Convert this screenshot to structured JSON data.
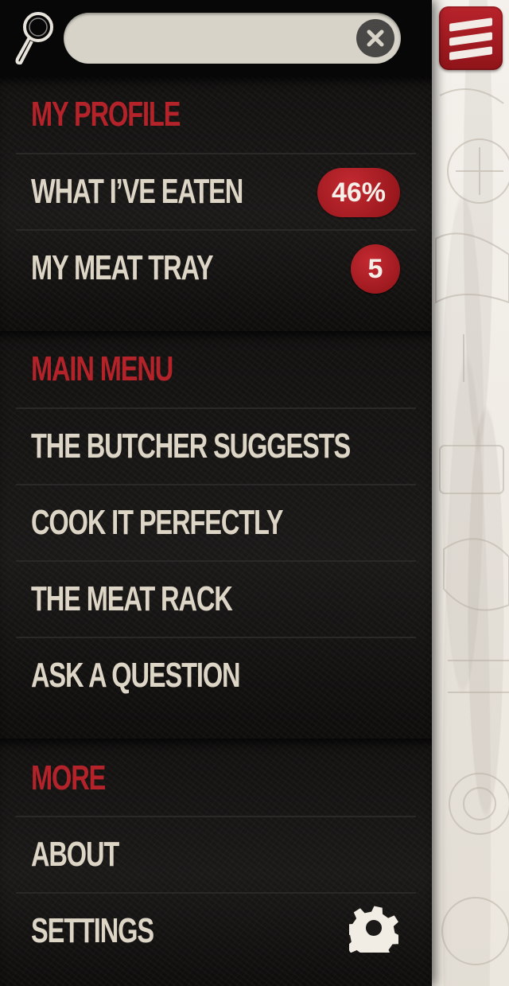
{
  "search": {
    "value": "",
    "placeholder": "",
    "icon": "magnifier-icon",
    "clear_icon": "clear-icon"
  },
  "menu_toggle": {
    "icon": "hamburger-menu-icon",
    "color": "#a51c23"
  },
  "profile": {
    "header": "MY PROFILE",
    "items": [
      {
        "label": "WHAT I’VE EATEN",
        "badge": "46%"
      },
      {
        "label": "MY MEAT TRAY",
        "badge": "5"
      }
    ]
  },
  "main_menu": {
    "header": "MAIN MENU",
    "items": [
      {
        "label": "THE BUTCHER SUGGESTS"
      },
      {
        "label": "COOK IT PERFECTLY"
      },
      {
        "label": "THE MEAT RACK"
      },
      {
        "label": "ASK A QUESTION"
      }
    ]
  },
  "more": {
    "header": "MORE",
    "items": [
      {
        "label": "ABOUT"
      },
      {
        "label": "SETTINGS",
        "icon": "gear-icon"
      }
    ]
  },
  "colors": {
    "accent_red": "#b5232a",
    "menu_text": "#ddd5c6",
    "drawer_bg": "#121110"
  }
}
